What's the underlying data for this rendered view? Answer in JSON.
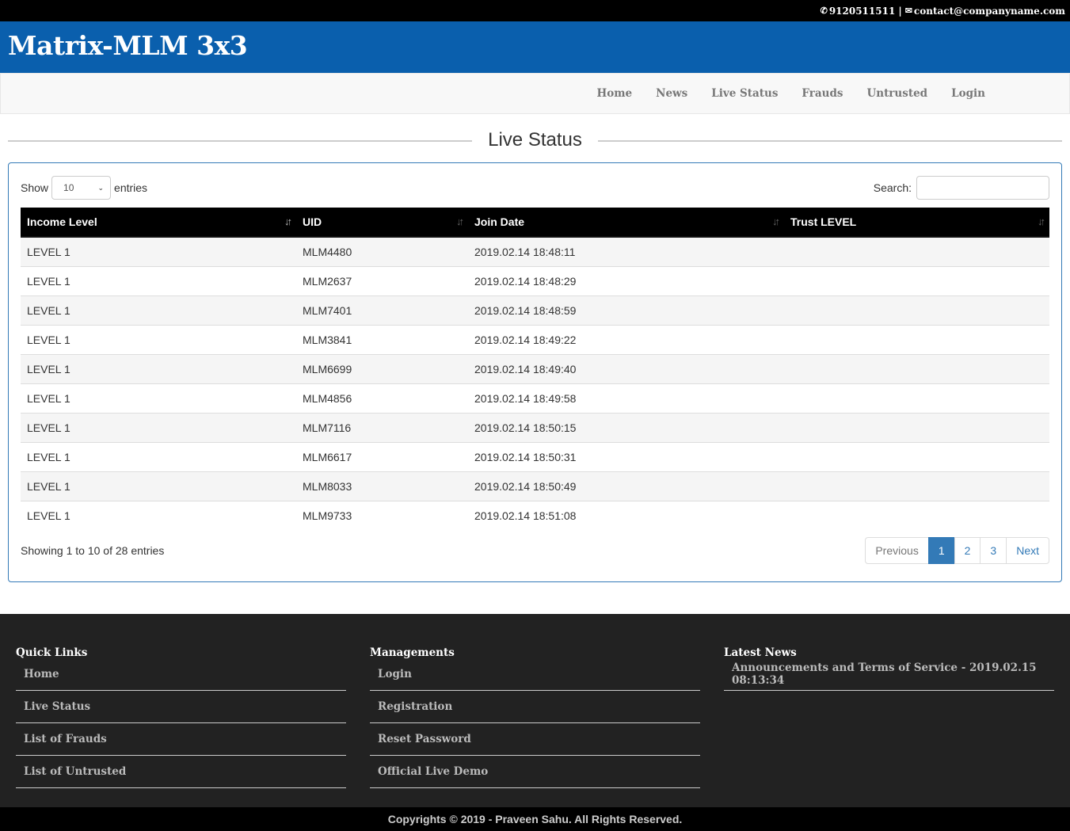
{
  "topbar": {
    "phone_icon": "phone-icon",
    "phone": "9120511511",
    "separator": "|",
    "mail_icon": "envelope-icon",
    "email": "contact@companyname.com"
  },
  "brand": {
    "title": "Matrix-MLM 3x3"
  },
  "nav": {
    "items": [
      {
        "label": "Home"
      },
      {
        "label": "News"
      },
      {
        "label": "Live Status"
      },
      {
        "label": "Frauds"
      },
      {
        "label": "Untrusted"
      },
      {
        "label": "Login"
      }
    ]
  },
  "page": {
    "title": "Live Status"
  },
  "table_controls": {
    "show_label": "Show",
    "entries_value": "10",
    "entries_label": "entries",
    "search_label": "Search:",
    "search_value": ""
  },
  "table": {
    "columns": [
      "Income Level",
      "UID",
      "Join Date",
      "Trust LEVEL"
    ],
    "rows": [
      [
        "LEVEL 1",
        "MLM4480",
        "2019.02.14 18:48:11",
        ""
      ],
      [
        "LEVEL 1",
        "MLM2637",
        "2019.02.14 18:48:29",
        ""
      ],
      [
        "LEVEL 1",
        "MLM7401",
        "2019.02.14 18:48:59",
        ""
      ],
      [
        "LEVEL 1",
        "MLM3841",
        "2019.02.14 18:49:22",
        ""
      ],
      [
        "LEVEL 1",
        "MLM6699",
        "2019.02.14 18:49:40",
        ""
      ],
      [
        "LEVEL 1",
        "MLM4856",
        "2019.02.14 18:49:58",
        ""
      ],
      [
        "LEVEL 1",
        "MLM7116",
        "2019.02.14 18:50:15",
        ""
      ],
      [
        "LEVEL 1",
        "MLM6617",
        "2019.02.14 18:50:31",
        ""
      ],
      [
        "LEVEL 1",
        "MLM8033",
        "2019.02.14 18:50:49",
        ""
      ],
      [
        "LEVEL 1",
        "MLM9733",
        "2019.02.14 18:51:08",
        ""
      ]
    ]
  },
  "pagination": {
    "info": "Showing 1 to 10 of 28 entries",
    "previous": "Previous",
    "pages": [
      "1",
      "2",
      "3"
    ],
    "next": "Next"
  },
  "footer": {
    "quick_links": {
      "title": "Quick Links",
      "items": [
        "Home",
        "Live Status",
        "List of Frauds",
        "List of Untrusted"
      ]
    },
    "managements": {
      "title": "Managements",
      "items": [
        "Login",
        "Registration",
        "Reset Password",
        "Official Live Demo"
      ]
    },
    "latest_news": {
      "title": "Latest News",
      "items": [
        "Announcements and Terms of Service - 2019.02.15 08:13:34"
      ]
    },
    "copyright": "Copyrights © 2019 - Praveen Sahu. All Rights Reserved."
  },
  "colors": {
    "brand_blue": "#0a5fad",
    "accent": "#337ab7",
    "table_header": "#000000",
    "footer_bg": "#222222"
  }
}
